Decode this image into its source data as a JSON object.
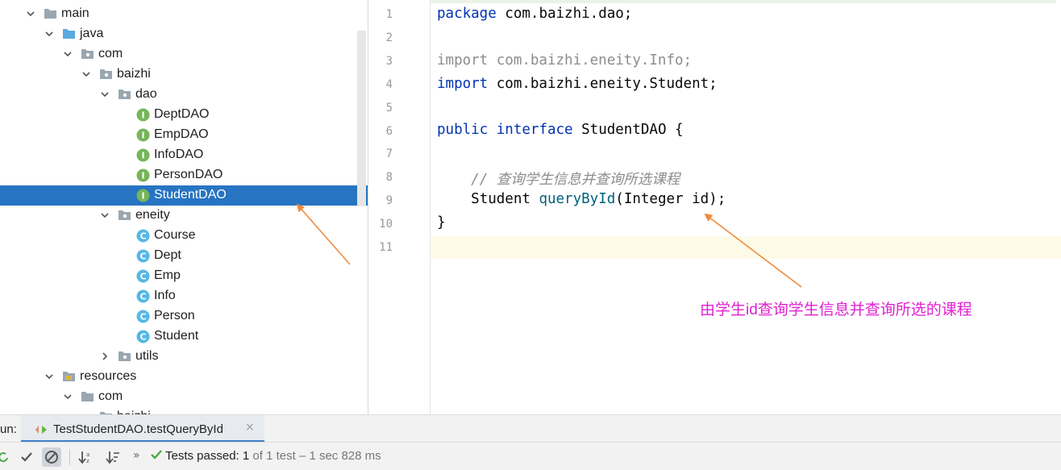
{
  "tree": {
    "items": [
      {
        "label": "main",
        "type": "folder",
        "expanded": true
      },
      {
        "label": "java",
        "type": "source-folder",
        "expanded": true
      },
      {
        "label": "com",
        "type": "package",
        "expanded": true
      },
      {
        "label": "baizhi",
        "type": "package",
        "expanded": true
      },
      {
        "label": "dao",
        "type": "package",
        "expanded": true
      },
      {
        "label": "DeptDAO",
        "type": "interface"
      },
      {
        "label": "EmpDAO",
        "type": "interface"
      },
      {
        "label": "InfoDAO",
        "type": "interface"
      },
      {
        "label": "PersonDAO",
        "type": "interface"
      },
      {
        "label": "StudentDAO",
        "type": "interface",
        "selected": true
      },
      {
        "label": "eneity",
        "type": "package",
        "expanded": true
      },
      {
        "label": "Course",
        "type": "class"
      },
      {
        "label": "Dept",
        "type": "class"
      },
      {
        "label": "Emp",
        "type": "class"
      },
      {
        "label": "Info",
        "type": "class"
      },
      {
        "label": "Person",
        "type": "class"
      },
      {
        "label": "Student",
        "type": "class"
      },
      {
        "label": "utils",
        "type": "package",
        "expanded": false
      },
      {
        "label": "resources",
        "type": "resources-folder",
        "expanded": true
      },
      {
        "label": "com",
        "type": "folder",
        "expanded": true
      },
      {
        "label": "baizhi",
        "type": "folder"
      }
    ]
  },
  "editor": {
    "line_numbers": [
      "1",
      "2",
      "3",
      "4",
      "5",
      "6",
      "7",
      "8",
      "9",
      "10",
      "11"
    ],
    "lines": {
      "l1_kw": "package",
      "l1_rest": " com.baizhi.dao;",
      "l3_kw": "import",
      "l3_rest": " com.baizhi.eneity.Info;",
      "l4_kw": "import",
      "l4_rest": " com.baizhi.eneity.Student;",
      "l6_kw1": "public",
      "l6_kw2": "interface",
      "l6_rest": " StudentDAO {",
      "l8_comment": "// 查询学生信息并查询所选课程",
      "l9_type": "Student ",
      "l9_fn": "queryById",
      "l9_rest": "(Integer id);",
      "l10": "}"
    }
  },
  "annotation": {
    "text": "由学生id查询学生信息并查询所选的课程",
    "color": "#e020d0"
  },
  "run": {
    "label": "un:",
    "tab_title": "TestStudentDAO.testQueryById",
    "tab_close": "×"
  },
  "status": {
    "passed_label": "Tests passed:",
    "passed_count": "1",
    "of_text": "of 1 test – 1 sec 828 ms"
  },
  "colors": {
    "selection": "#2774c2",
    "keyword": "#0033b3",
    "method": "#00627a",
    "comment": "#8c8c8c",
    "arrow": "#f08a3c",
    "pass": "#4aa84a"
  }
}
